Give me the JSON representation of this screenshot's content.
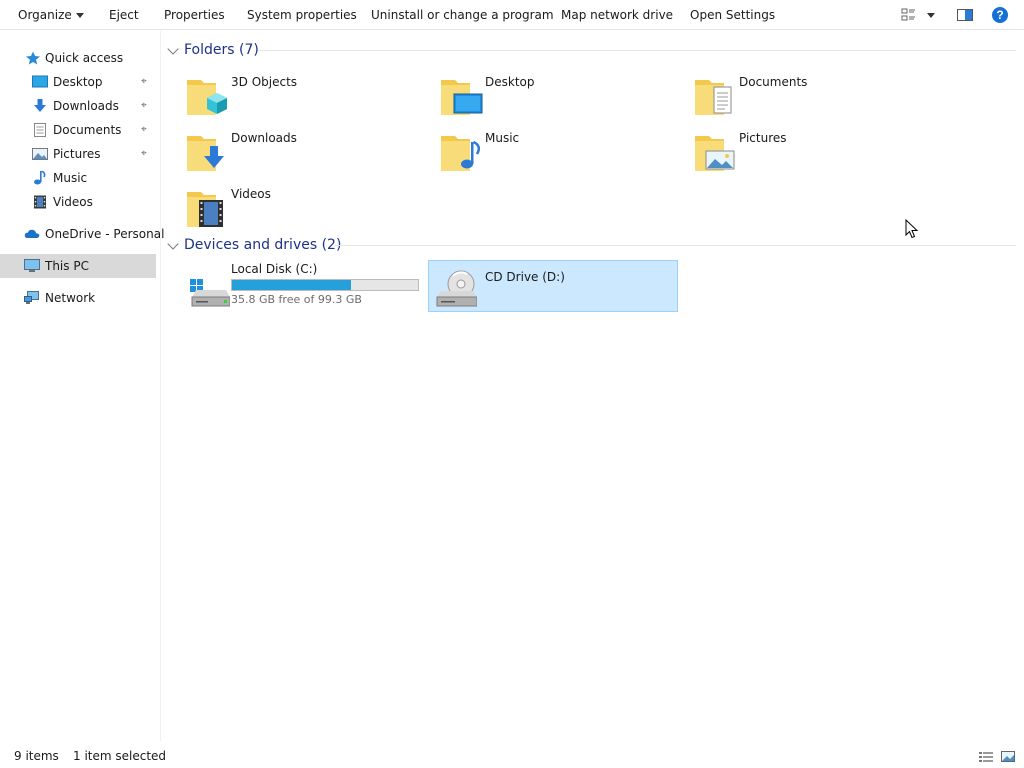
{
  "toolbar": {
    "organize": "Organize",
    "eject": "Eject",
    "properties": "Properties",
    "system_properties": "System properties",
    "uninstall": "Uninstall or change a program",
    "map_network_drive": "Map network drive",
    "open_settings": "Open Settings",
    "icons": [
      "change-view-icon",
      "preview-pane-icon",
      "help-icon"
    ]
  },
  "sidebar": {
    "items": [
      {
        "label": "Quick access",
        "icon": "star-icon"
      },
      {
        "label": "Desktop",
        "icon": "desktop-icon",
        "pinned": true
      },
      {
        "label": "Downloads",
        "icon": "download-arrow-icon",
        "pinned": true
      },
      {
        "label": "Documents",
        "icon": "document-icon",
        "pinned": true
      },
      {
        "label": "Pictures",
        "icon": "picture-icon",
        "pinned": true
      },
      {
        "label": "Music",
        "icon": "music-note-icon"
      },
      {
        "label": "Videos",
        "icon": "film-icon"
      },
      {
        "label": "OneDrive - Personal",
        "icon": "cloud-icon"
      },
      {
        "label": "This PC",
        "icon": "monitor-icon",
        "selected": true
      },
      {
        "label": "Network",
        "icon": "network-icon"
      }
    ],
    "pin_glyph": "📌"
  },
  "folders": {
    "header": "Folders (7)",
    "items": [
      {
        "label": "3D Objects",
        "icon": "3d-objects-folder-icon"
      },
      {
        "label": "Desktop",
        "icon": "desktop-folder-icon"
      },
      {
        "label": "Documents",
        "icon": "documents-folder-icon"
      },
      {
        "label": "Downloads",
        "icon": "downloads-folder-icon"
      },
      {
        "label": "Music",
        "icon": "music-folder-icon"
      },
      {
        "label": "Pictures",
        "icon": "pictures-folder-icon"
      },
      {
        "label": "Videos",
        "icon": "videos-folder-icon"
      }
    ]
  },
  "devices": {
    "header": "Devices and drives (2)",
    "local_disk": {
      "name": "Local Disk (C:)",
      "free_text": "35.8 GB free of 99.3 GB",
      "used_fraction": 0.64,
      "icon": "hard-drive-icon"
    },
    "cd_drive": {
      "name": "CD Drive (D:)",
      "icon": "cd-drive-icon",
      "selected": true
    }
  },
  "status": {
    "items": "9 items",
    "selected": "1 item selected"
  },
  "colors": {
    "accent": "#26a0da",
    "selection": "#cce8ff",
    "group_header": "#1e3287",
    "folder": "#f2c94c"
  }
}
